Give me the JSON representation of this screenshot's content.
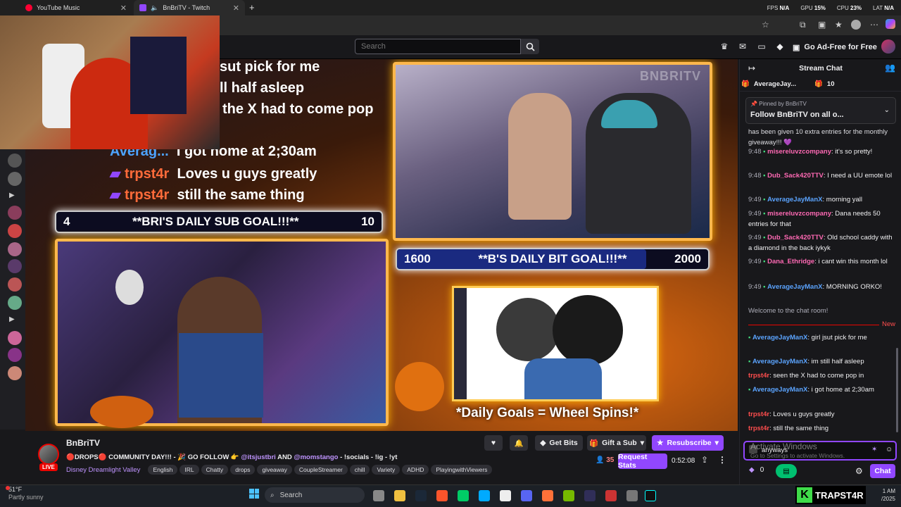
{
  "browser": {
    "tabs": [
      {
        "label": "YouTube Music"
      },
      {
        "label": "BnBriTV - Twitch"
      }
    ],
    "perf": {
      "fps_label": "FPS",
      "fps": "N/A",
      "gpu_label": "GPU",
      "gpu": "15%",
      "cpu_label": "CPU",
      "cpu": "23%",
      "lat_label": "LAT",
      "lat": "N/A"
    }
  },
  "topnav": {
    "search_placeholder": "Search",
    "adfree_label": "Go Ad-Free for Free"
  },
  "stream": {
    "overlay_chat": [
      {
        "name": "",
        "text": "sut pick for me"
      },
      {
        "name": "",
        "text": "ll half asleep"
      },
      {
        "name": "",
        "text": "the X had to come pop"
      },
      {
        "name": "Averag...",
        "text": "I got home at 2;30am"
      },
      {
        "name": "trpst4r",
        "text": "Loves u guys greatly"
      },
      {
        "name": "trpst4r",
        "text": "still the same thing"
      }
    ],
    "sub_goal": {
      "left": "4",
      "label": "**BRI'S DAILY SUB GOAL!!!**",
      "right": "10"
    },
    "bit_goal": {
      "left": "1600",
      "label": "**B'S DAILY BIT GOAL!!!**",
      "right": "2000"
    },
    "wheel_text": "*Daily Goals = Wheel Spins!*",
    "watermark": "BNBRITV"
  },
  "info": {
    "channel_name": "BnBriTV",
    "live_badge": "LIVE",
    "title_parts": {
      "a": "🔴DROPS🔴 COMMUNITY DAY!!! - 🎉 GO FOLLOW 👉",
      "mention1": "@itsjustbri",
      "and": "AND",
      "mention2": "@momstango",
      "b": "- !socials - !ig - !yt"
    },
    "game": "Disney Dreamlight Valley",
    "tags": [
      "English",
      "IRL",
      "Chatty",
      "drops",
      "giveaway",
      "CoupleStreamer",
      "chill",
      "Variety",
      "ADHD",
      "PlayingwithViewers"
    ],
    "get_bits": "Get Bits",
    "gift_sub": "Gift a Sub",
    "resubscribe": "Resubscribe",
    "viewers": "35",
    "request_stats": "Request Stats",
    "uptime": "0:52:08"
  },
  "chat": {
    "header": "Stream Chat",
    "gift_user": "AverageJay...",
    "gift_count": "10",
    "pinned_by_label": "Pinned by",
    "pinned_by": "BnBriTV",
    "pinned_text": "Follow BnBriTV on all o...",
    "clip_text": "has been given 10 extra entries for the monthly giveaway!!!",
    "messages": [
      {
        "time": "9:48",
        "user": "misereluvzcompany",
        "color": "pink",
        "text": ": it's so pretty!"
      },
      {
        "time": "9:48",
        "user": "Dub_Sack420TTV",
        "color": "pink",
        "text": ": I need a UU emote lol"
      },
      {
        "time": "9:49",
        "user": "AverageJayManX",
        "color": "blue",
        "text": ": morning yall"
      },
      {
        "time": "9:49",
        "user": "misereluvzcompany",
        "color": "pink",
        "text": ": Dana needs 50 entries for that"
      },
      {
        "time": "9:49",
        "user": "Dub_Sack420TTV",
        "color": "pink",
        "text": ": Old school caddy with a diamond in the back iykyk"
      },
      {
        "time": "9:49",
        "user": "Dana_Ethridge",
        "color": "pink",
        "text": ": i cant win this month lol"
      },
      {
        "time": "9:49",
        "user": "AverageJayManX",
        "color": "blue",
        "text": ": MORNING ORKO!"
      }
    ],
    "welcome": "Welcome to the chat room!",
    "new_label": "New",
    "messages2": [
      {
        "user": "AverageJayManX",
        "color": "blue",
        "text": ": girl jsut pick for me"
      },
      {
        "user": "AverageJayManX",
        "color": "blue",
        "text": ": im still half asleep"
      },
      {
        "user": "trpst4r",
        "color": "red",
        "text": ": seen the X had to come pop in"
      },
      {
        "user": "AverageJayManX",
        "color": "blue",
        "text": ": i got home at 2;30am"
      },
      {
        "user": "trpst4r",
        "color": "red",
        "text": ": Loves u guys greatly"
      },
      {
        "user": "trpst4r",
        "color": "red",
        "text": ": still the same thing"
      }
    ],
    "input_value": "anyways",
    "activate_title": "Activate Windows",
    "activate_sub": "Go to Settings to activate Windows.",
    "points": "0",
    "chat_button": "Chat"
  },
  "taskbar": {
    "weather_temp": "51°F",
    "weather_desc": "Partly sunny",
    "search_label": "Search",
    "time": "1 AM",
    "date": "/2025",
    "brand": "TRAPST4R",
    "brand_k": "K"
  }
}
